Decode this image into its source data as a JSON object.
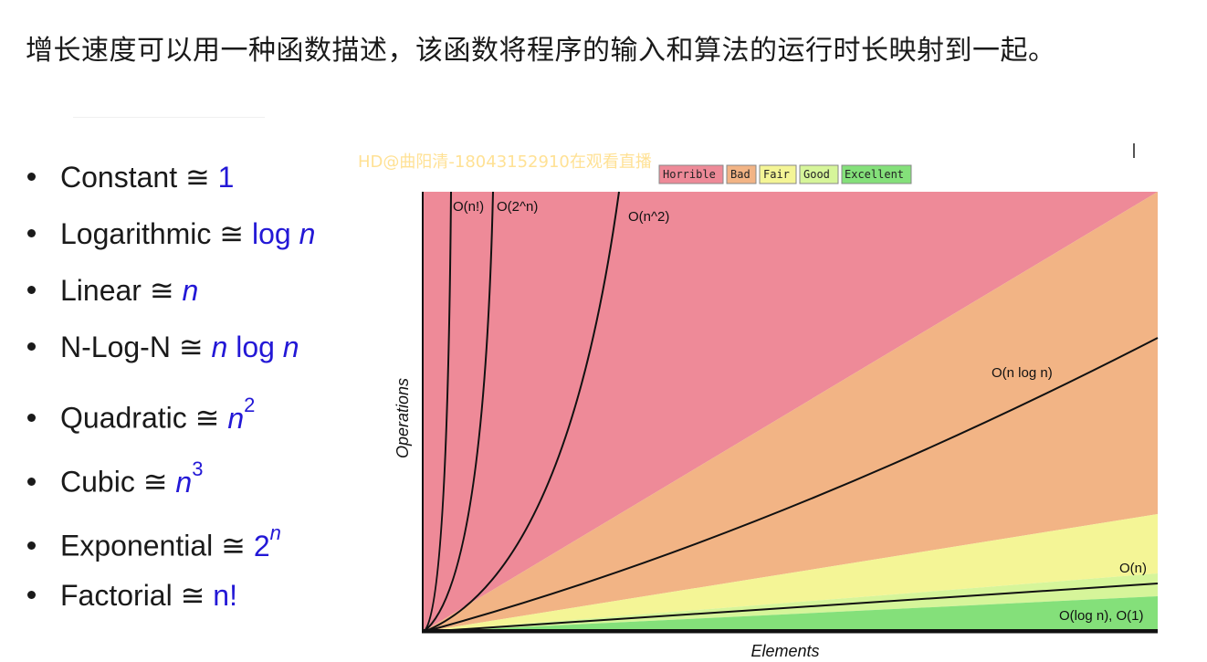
{
  "heading": "增长速度可以用一种函数描述，该函数将程序的输入和算法的运行时长映射到一起。",
  "watermark": "HD@曲阳清-18043152910在观看直播",
  "list": [
    {
      "name": "Constant",
      "op": "≅",
      "expr_html": "1"
    },
    {
      "name": "Logarithmic",
      "op": "≅",
      "expr_html": "log <i>n</i>"
    },
    {
      "name": "Linear",
      "op": "≅",
      "expr_html": "<i>n</i>"
    },
    {
      "name": "N-Log-N",
      "op": "≅",
      "expr_html": "<i>n</i> log <i>n</i>"
    },
    {
      "name": "Quadratic",
      "op": "≅",
      "expr_html": "<i>n</i><sup>2</sup>"
    },
    {
      "name": "Cubic",
      "op": "≅",
      "expr_html": "<i>n</i><sup>3</sup>"
    },
    {
      "name": "Exponential",
      "op": "≅",
      "expr_html": "2<sup><i>n</i></sup>"
    },
    {
      "name": "Factorial",
      "op": "≅",
      "expr_html": "n!"
    }
  ],
  "colors": {
    "expr": "#2318d6",
    "horrible": "#ee8a98",
    "bad": "#f2b485",
    "fair": "#f4f596",
    "good": "#d6f59a",
    "excellent": "#84e07a"
  },
  "chart_data": {
    "type": "line",
    "title": "",
    "xlabel": "Elements",
    "ylabel": "Operations",
    "legend": {
      "placement": "top-center",
      "entries": [
        {
          "label": "Horrible",
          "color": "#ee8a98"
        },
        {
          "label": "Bad",
          "color": "#f2b485"
        },
        {
          "label": "Fair",
          "color": "#f4f596"
        },
        {
          "label": "Good",
          "color": "#d6f59a"
        },
        {
          "label": "Excellent",
          "color": "#84e07a"
        }
      ]
    },
    "series_labels": [
      "O(n!)",
      "O(2^n)",
      "O(n^2)",
      "O(n log n)",
      "O(n)",
      "O(log n), O(1)"
    ],
    "grid": false
  }
}
